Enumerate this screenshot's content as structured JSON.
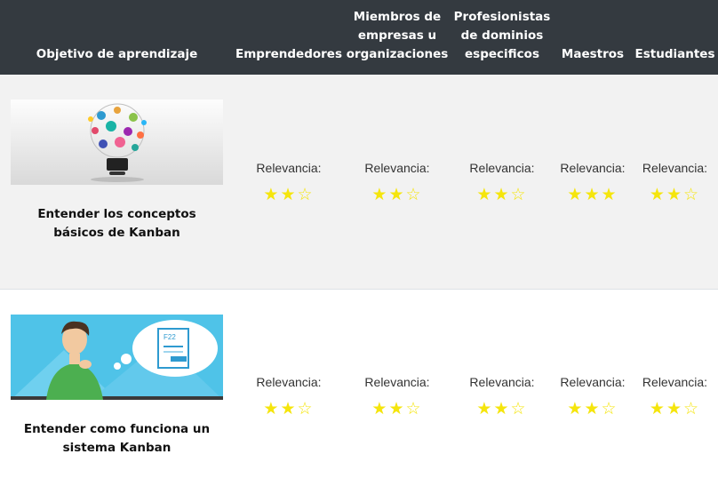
{
  "headers": {
    "objective": "Objetivo de aprendizaje",
    "col1": "Emprendedores",
    "col2": "Miembros de empresas u organizaciones",
    "col3": "Profesionistas de dominios especificos",
    "col4": "Maestros",
    "col5": "Estudiantes"
  },
  "relevance_label": "Relevancia:",
  "star_max": 3,
  "rows": [
    {
      "title": "Entender los conceptos básicos de Kanban",
      "image": "lightbulb-illustration",
      "ratings": [
        2,
        2,
        2,
        3,
        2
      ]
    },
    {
      "title": "Entender como funciona un sistema Kanban",
      "image": "thinking-man-illustration",
      "ratings": [
        2,
        2,
        2,
        2,
        2
      ]
    }
  ],
  "colors": {
    "header_bg": "#343a40",
    "star": "#f5e50c",
    "row_alt": "#f2f2f2"
  }
}
